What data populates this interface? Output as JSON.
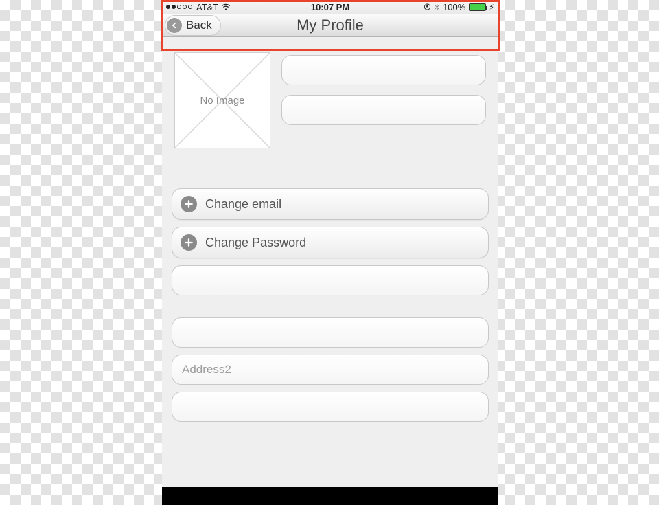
{
  "status": {
    "carrier": "AT&T",
    "time": "10:07 PM",
    "battery_pct": "100%"
  },
  "nav": {
    "back_label": "Back",
    "title": "My Profile"
  },
  "avatar": {
    "placeholder": "No Image"
  },
  "fields": {
    "first_name": "",
    "last_name": "",
    "phone": "",
    "address1": "",
    "address2_placeholder": "Address2",
    "address2": "",
    "city": ""
  },
  "actions": {
    "change_email": "Change email",
    "change_password": "Change Password"
  }
}
